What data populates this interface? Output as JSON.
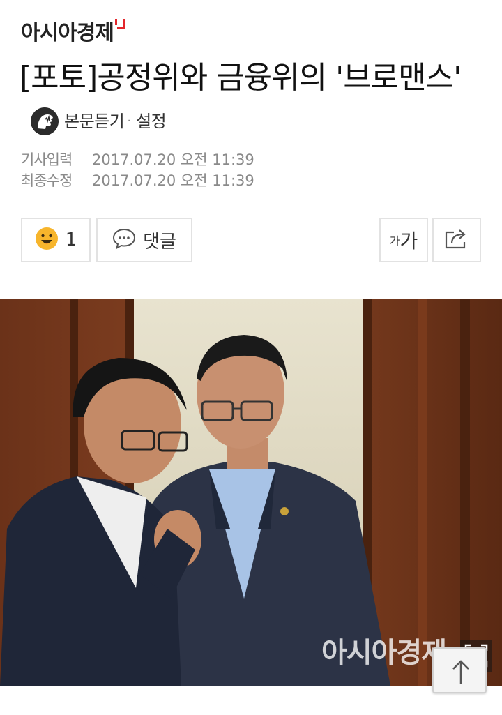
{
  "brand": {
    "name": "아시아경제"
  },
  "article": {
    "title": "[포토]공정위와 금융위의 '브로맨스'",
    "tts": {
      "listen_label": "본문듣기",
      "separator": "·",
      "settings_label": "설정",
      "icon": "audio-speaker-icon"
    },
    "meta": {
      "published_label": "기사입력",
      "published_value": "2017.07.20 오전 11:39",
      "modified_label": "최종수정",
      "modified_value": "2017.07.20 오전 11:39"
    }
  },
  "actions": {
    "reaction_count": "1",
    "reaction_icon": "smiley-icon",
    "comment_label": "댓글",
    "comment_icon": "speech-bubble-icon",
    "font_small": "가",
    "font_large": "가",
    "share_icon": "share-icon"
  },
  "photo": {
    "watermark": "아시아경제",
    "expand_icon": "expand-icon"
  },
  "scroll_top": {
    "icon": "arrow-up-icon"
  },
  "colors": {
    "brand_red": "#e3262b",
    "border": "#e2e2e2",
    "meta_gray": "#8a8a8a",
    "smiley": "#f7b52c"
  }
}
